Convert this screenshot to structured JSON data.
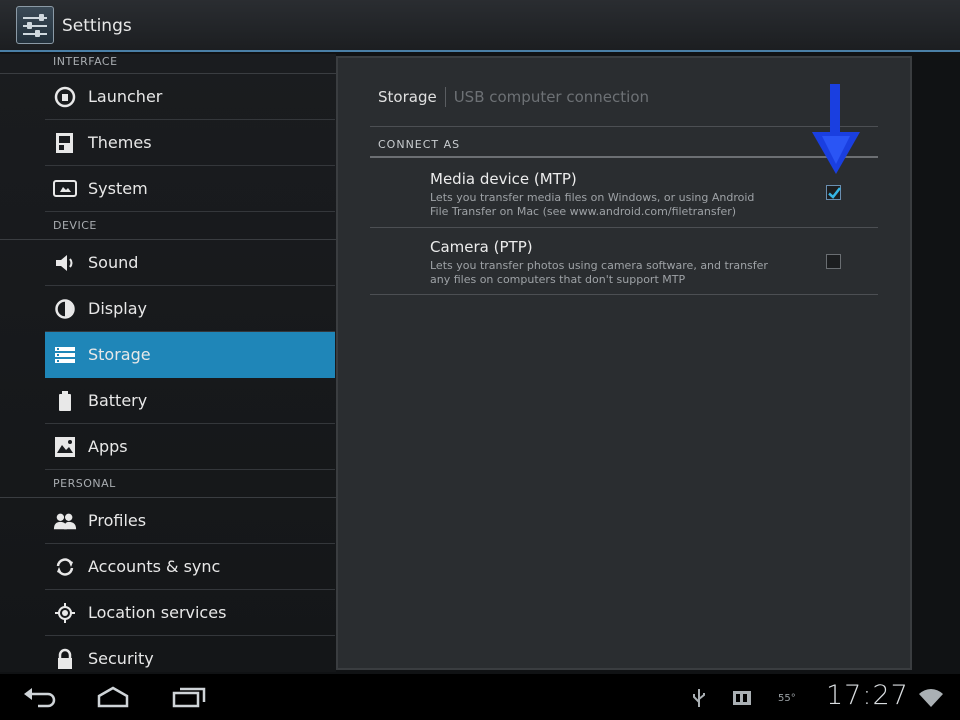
{
  "app": {
    "title": "Settings"
  },
  "sidebar": {
    "sections": [
      {
        "label": "INTERFACE",
        "items": [
          {
            "label": "Launcher",
            "icon": "launcher-icon"
          },
          {
            "label": "Themes",
            "icon": "themes-icon"
          },
          {
            "label": "System",
            "icon": "system-icon"
          }
        ]
      },
      {
        "label": "DEVICE",
        "items": [
          {
            "label": "Sound",
            "icon": "sound-icon"
          },
          {
            "label": "Display",
            "icon": "display-icon"
          },
          {
            "label": "Storage",
            "icon": "storage-icon",
            "selected": true
          },
          {
            "label": "Battery",
            "icon": "battery-icon"
          },
          {
            "label": "Apps",
            "icon": "apps-icon"
          }
        ]
      },
      {
        "label": "PERSONAL",
        "items": [
          {
            "label": "Profiles",
            "icon": "profiles-icon"
          },
          {
            "label": "Accounts & sync",
            "icon": "sync-icon"
          },
          {
            "label": "Location services",
            "icon": "location-icon"
          },
          {
            "label": "Security",
            "icon": "lock-icon"
          }
        ]
      }
    ]
  },
  "main": {
    "breadcrumb": {
      "current": "Storage",
      "other": "USB computer connection"
    },
    "group_header": "CONNECT AS",
    "options": [
      {
        "title": "Media device (MTP)",
        "summary_line1": "Lets you transfer media files on Windows, or using Android",
        "summary_line2": "File Transfer on Mac (see www.android.com/filetransfer)",
        "checked": true
      },
      {
        "title": "Camera (PTP)",
        "summary_line1": "Lets you transfer photos using camera software, and transfer",
        "summary_line2": "any files on computers that don't support MTP",
        "checked": false
      }
    ]
  },
  "statusbar": {
    "time": "17:27",
    "temp": "55°"
  },
  "colors": {
    "accent": "#1f86b8",
    "arrow": "#1a3fe0",
    "background": "#2a2d30"
  }
}
